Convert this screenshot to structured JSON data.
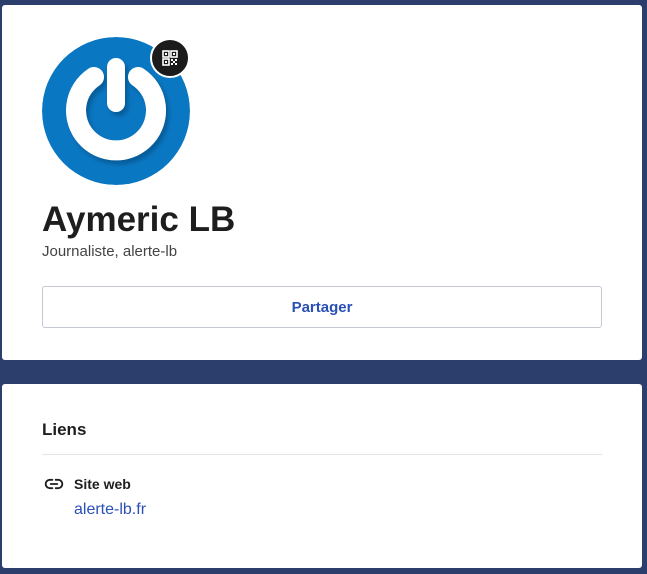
{
  "profile": {
    "name": "Aymeric LB",
    "subtitle": "Journaliste, alerte-lb",
    "share_label": "Partager",
    "avatar_icon": "power-logo-icon",
    "badge_icon": "qr-code-icon",
    "colors": {
      "avatar_blue": "#0a77c2",
      "share_text": "#2a50b5",
      "background": "#2c3e6b"
    }
  },
  "links": {
    "title": "Liens",
    "items": [
      {
        "icon": "link-icon",
        "label": "Site web",
        "url_text": "alerte-lb.fr"
      }
    ]
  }
}
